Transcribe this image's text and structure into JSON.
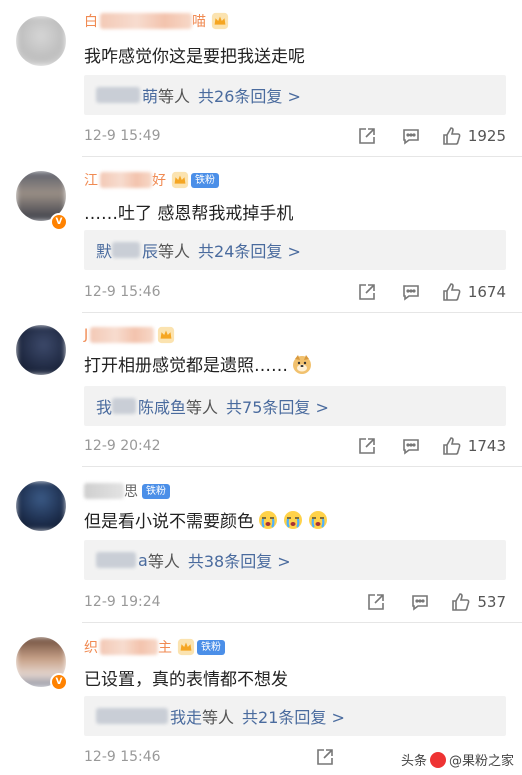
{
  "comments": [
    {
      "user": {
        "name_visible_head": "白",
        "name_visible_tail": "喵"
      },
      "text": "我咋感觉你这是要把我送走呢",
      "replies": {
        "name_visible": "萌",
        "suffix": "等人",
        "count_text": "共26条回复 >"
      },
      "time": "12-9 15:49",
      "likes": "1925"
    },
    {
      "user": {
        "name_visible_head": "江",
        "name_visible_tail": "好",
        "fan_badge": "铁粉"
      },
      "text": "……吐了 感恩帮我戒掉手机",
      "replies": {
        "name_visible_head": "默",
        "name_visible": "辰",
        "suffix": "等人",
        "count_text": "共24条回复 >"
      },
      "time": "12-9 15:46",
      "likes": "1674"
    },
    {
      "user": {
        "name_visible_head": "J"
      },
      "text": "打开相册感觉都是遗照……",
      "replies": {
        "name_visible_head": "我",
        "name_visible": "陈咸鱼",
        "suffix": "等人",
        "count_text": "共75条回复 >"
      },
      "time": "12-9 20:42",
      "likes": "1743"
    },
    {
      "user": {
        "name_visible_tail": "思",
        "fan_badge": "铁粉"
      },
      "text": "但是看小说不需要颜色",
      "replies": {
        "name_visible": "a",
        "suffix": "等人",
        "count_text": "共38条回复 >"
      },
      "time": "12-9 19:24",
      "likes": "537"
    },
    {
      "user": {
        "name_visible_head": "织",
        "name_visible_tail": "主",
        "fan_badge": "铁粉"
      },
      "text": "已设置，真的表情都不想发",
      "replies": {
        "name_visible": "我走",
        "suffix": "等人",
        "count_text": "共21条回复 >"
      },
      "time": "12-9 15:46",
      "likes": ""
    }
  ],
  "watermark": {
    "prefix": "头条",
    "brand": "@果粉之家"
  },
  "colors": {
    "link": "#4a6b9e",
    "fan_badge": "#4b8fe8",
    "vip": "#ff8200"
  }
}
